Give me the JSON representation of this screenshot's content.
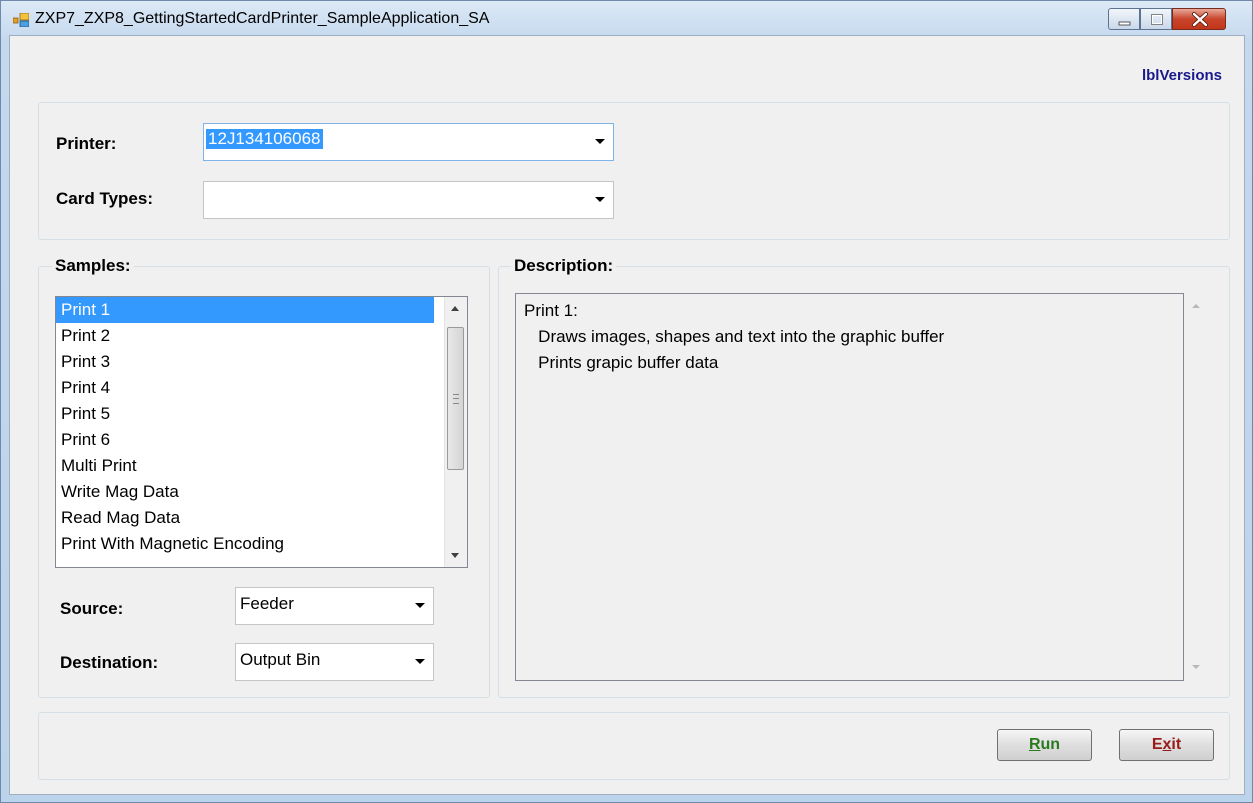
{
  "window": {
    "title": "ZXP7_ZXP8_GettingStartedCardPrinter_SampleApplication_SA"
  },
  "header": {
    "versions_label": "lblVersions"
  },
  "printer_panel": {
    "printer_label": "Printer:",
    "printer_value": "12J134106068",
    "card_types_label": "Card Types:",
    "card_types_value": ""
  },
  "samples": {
    "title": "Samples:",
    "items": [
      "Print 1",
      "Print 2",
      "Print 3",
      "Print 4",
      "Print 5",
      "Print 6",
      "Multi Print",
      "Write Mag Data",
      "Read Mag Data",
      "Print With Magnetic Encoding"
    ],
    "selected_index": 0,
    "source_label": "Source:",
    "source_value": "Feeder",
    "destination_label": "Destination:",
    "destination_value": "Output Bin"
  },
  "description": {
    "title": "Description:",
    "lines": [
      "Print 1:",
      "   Draws images, shapes and text into the graphic buffer",
      "   Prints grapic buffer data"
    ]
  },
  "buttons": {
    "run_mnemonic": "R",
    "run_rest": "un",
    "exit_first": "E",
    "exit_mnemonic": "x",
    "exit_rest": "it"
  },
  "colors": {
    "selection": "#3399ff",
    "versions_text": "#1a1a8c",
    "run_text": "#2a7a20",
    "exit_text": "#9a1a1a"
  }
}
